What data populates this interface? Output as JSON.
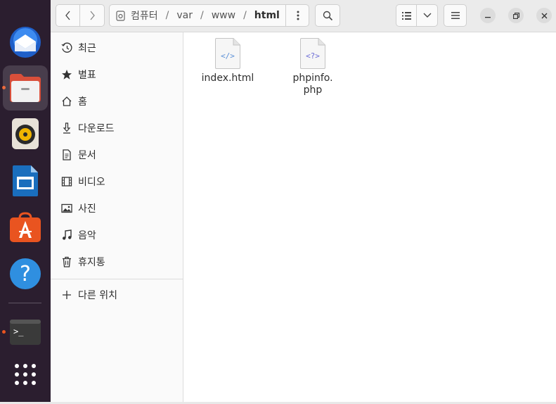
{
  "dock": {
    "items": [
      {
        "name": "thunderbird",
        "running": false
      },
      {
        "name": "files",
        "running": true,
        "active": true
      },
      {
        "name": "rhythmbox",
        "running": false
      },
      {
        "name": "libreoffice-writer",
        "running": false
      },
      {
        "name": "app-center",
        "running": false
      },
      {
        "name": "help",
        "running": false
      },
      {
        "name": "terminal",
        "running": true
      },
      {
        "name": "show-apps",
        "running": false
      }
    ],
    "accent_color": "#e95420"
  },
  "path": {
    "root_label": "컴퓨터",
    "segments": [
      "var",
      "www"
    ],
    "current": "html"
  },
  "sidebar": {
    "items": [
      {
        "label": "최근",
        "icon": "clock-icon"
      },
      {
        "label": "별표",
        "icon": "star-icon"
      },
      {
        "label": "홈",
        "icon": "home-icon"
      },
      {
        "label": "다운로드",
        "icon": "download-icon"
      },
      {
        "label": "문서",
        "icon": "document-icon"
      },
      {
        "label": "비디오",
        "icon": "video-icon"
      },
      {
        "label": "사진",
        "icon": "picture-icon"
      },
      {
        "label": "음악",
        "icon": "music-icon"
      },
      {
        "label": "휴지통",
        "icon": "trash-icon"
      }
    ],
    "other_locations": "다른 위치"
  },
  "files": [
    {
      "name": "index.html",
      "glyph": "</>"
    },
    {
      "name": "phpinfo.\nphp",
      "glyph": "<?>"
    }
  ]
}
